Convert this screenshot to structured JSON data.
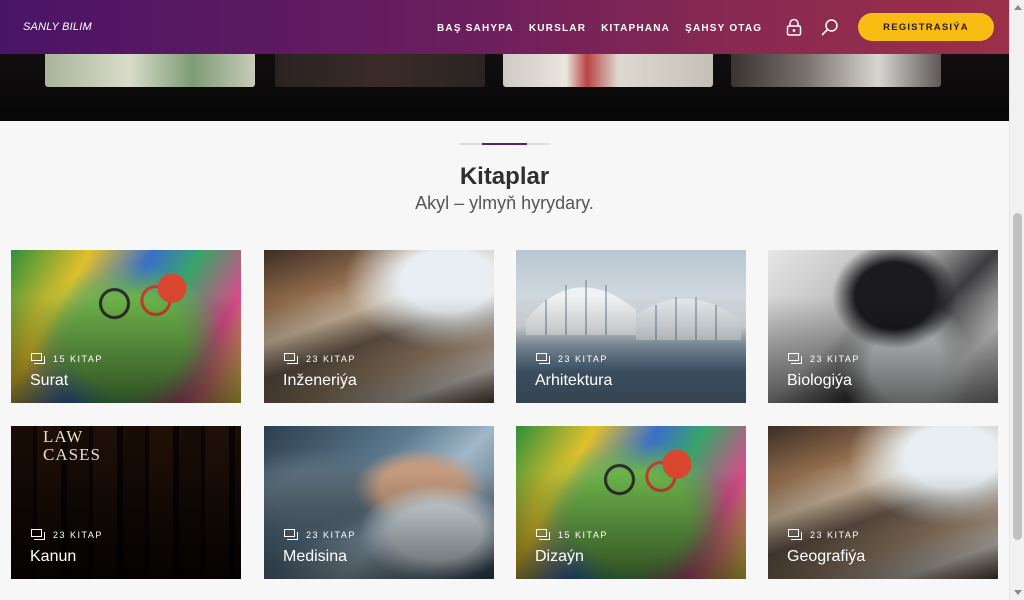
{
  "brand": "SANLY BILIM",
  "nav": {
    "items": [
      "BAŞ SAHYPA",
      "KURSLAR",
      "KITAPHANA",
      "ŞAHSY OTAG"
    ],
    "register_label": "REGISTRASIÝA",
    "icons": [
      "lock-icon",
      "search-icon"
    ]
  },
  "section": {
    "title": "Kitaplar",
    "subtitle": "Akyl – ylmyň hyrydary."
  },
  "categories": [
    {
      "name": "Surat",
      "count": "15 KITAP"
    },
    {
      "name": "Inženeriýa",
      "count": "23 KITAP"
    },
    {
      "name": "Arhitektura",
      "count": "23 KITAP"
    },
    {
      "name": "Biologiýa",
      "count": "23 KITAP"
    },
    {
      "name": "Kanun",
      "count": "23 KITAP"
    },
    {
      "name": "Medisina",
      "count": "23 KITAP"
    },
    {
      "name": "Dizaýn",
      "count": "15 KITAP"
    },
    {
      "name": "Geografiýa",
      "count": "23 KITAP"
    }
  ],
  "card_images": {
    "law_book_text": "LAW CASES"
  },
  "colors": {
    "accent": "#5b1f7a",
    "register_button": "#f8bd13",
    "nav_gradient_start": "#4a1466",
    "nav_gradient_end": "#9a3048"
  }
}
